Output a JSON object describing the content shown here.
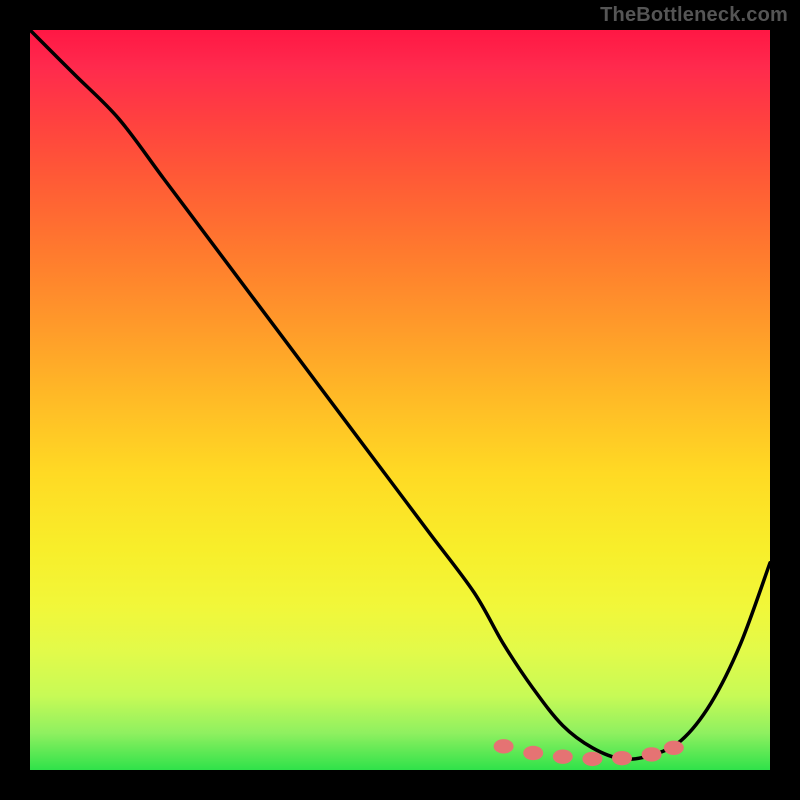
{
  "watermark": "TheBottleneck.com",
  "chart_data": {
    "type": "line",
    "title": "",
    "xlabel": "",
    "ylabel": "",
    "xlim": [
      0,
      100
    ],
    "ylim": [
      0,
      100
    ],
    "grid": false,
    "legend": false,
    "series": [
      {
        "name": "curve",
        "color": "#000000",
        "x": [
          0,
          6,
          12,
          18,
          24,
          30,
          36,
          42,
          48,
          54,
          60,
          64,
          68,
          72,
          76,
          80,
          84,
          88,
          92,
          96,
          100
        ],
        "values": [
          100,
          94,
          88,
          80,
          72,
          64,
          56,
          48,
          40,
          32,
          24,
          17,
          11,
          6,
          3,
          1.5,
          2,
          4,
          9,
          17,
          28
        ]
      }
    ],
    "markers": {
      "name": "bottom-dots",
      "color": "#e57373",
      "radius_px": 8,
      "x": [
        64,
        68,
        72,
        76,
        80,
        84,
        87
      ],
      "values": [
        3.2,
        2.3,
        1.8,
        1.5,
        1.6,
        2.1,
        3.0
      ]
    },
    "gradient_stops": [
      {
        "offset": 0.0,
        "color": "#ff1744"
      },
      {
        "offset": 0.5,
        "color": "#ffbb26"
      },
      {
        "offset": 0.78,
        "color": "#f1f73a"
      },
      {
        "offset": 1.0,
        "color": "#2fe24a"
      }
    ]
  }
}
